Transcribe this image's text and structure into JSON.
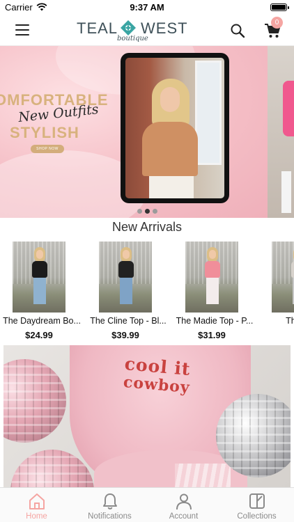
{
  "status_bar": {
    "carrier": "Carrier",
    "time": "9:37 AM",
    "battery_level": 1.0
  },
  "nav": {
    "logo_left": "TEAL",
    "logo_right": "WEST",
    "logo_sub": "boutique",
    "cart_count": "0",
    "icons": {
      "menu": "hamburger-menu-icon",
      "search": "search-icon",
      "cart": "cart-icon"
    }
  },
  "banner": {
    "headline_line1": "OMFORTABLE",
    "headline_line2": "STYLISH",
    "script_text": "New Outfits",
    "cta": "SHOP NOW",
    "active_slide": 2,
    "slide_count": 3
  },
  "new_arrivals": {
    "title": "New Arrivals",
    "products": [
      {
        "name": "The Daydream Bo...",
        "price": "$24.99"
      },
      {
        "name": "The Cline Top - Bl...",
        "price": "$39.99"
      },
      {
        "name": "The Madie Top - P...",
        "price": "$31.99"
      },
      {
        "name": "The Hal",
        "price": "$"
      }
    ]
  },
  "promo": {
    "cap_line1": "cool it",
    "cap_line2": "cowboy"
  },
  "tab_bar": {
    "tabs": [
      {
        "label": "Home",
        "icon": "home-icon",
        "active": true
      },
      {
        "label": "Notifications",
        "icon": "bell-icon",
        "active": false
      },
      {
        "label": "Account",
        "icon": "user-icon",
        "active": false
      },
      {
        "label": "Collections",
        "icon": "collections-icon",
        "active": false
      }
    ]
  },
  "colors": {
    "accent": "#f5a5a2",
    "logo": "#3f5159",
    "gem": "#3aa5a3",
    "banner_gold": "#d8b27e"
  }
}
